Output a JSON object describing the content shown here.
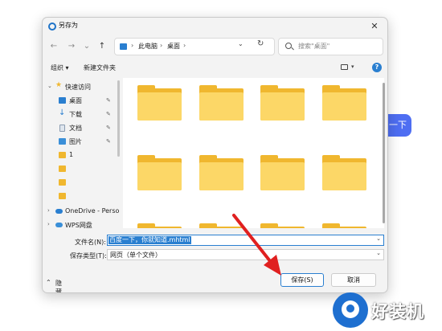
{
  "window": {
    "title": "另存为",
    "close_symbol": "✕"
  },
  "nav": {
    "back": "←",
    "forward": "→",
    "recent": "⌄",
    "up": "↑",
    "breadcrumb": [
      "此电脑",
      "桌面"
    ],
    "separator": "›",
    "address_dropdown": "⌄",
    "refresh": "↻",
    "search_placeholder": "搜索\"桌面\""
  },
  "toolbar": {
    "organize": "组织 ▾",
    "new_folder": "新建文件夹",
    "view_dropdown": "▾",
    "help": "?"
  },
  "sidebar": {
    "items": [
      {
        "label": "快速访问",
        "icon": "star-icon",
        "chevron": "⌄"
      },
      {
        "label": "桌面",
        "icon": "desktop-icon",
        "pin": "📌"
      },
      {
        "label": "下载",
        "icon": "download-icon",
        "pin": "📌"
      },
      {
        "label": "文档",
        "icon": "document-icon",
        "pin": "📌"
      },
      {
        "label": "图片",
        "icon": "picture-icon",
        "pin": "📌"
      },
      {
        "label": "1",
        "icon": "folder-icon"
      },
      {
        "label": "",
        "icon": "folder-icon"
      },
      {
        "label": "",
        "icon": "folder-icon"
      },
      {
        "label": "",
        "icon": "folder-icon"
      },
      {
        "label": "OneDrive - Perso",
        "icon": "cloud-icon",
        "chevron": "›"
      },
      {
        "label": "WPS网盘",
        "icon": "cloud-icon",
        "chevron": "›"
      }
    ]
  },
  "files": {
    "folder_count_visible": 12
  },
  "fields": {
    "filename_label": "文件名(N):",
    "filename_value": "百度一下，你就知道.mhtml",
    "type_label": "保存类型(T):",
    "type_value": "网页（单个文件）",
    "dropdown": "⌄"
  },
  "footer": {
    "hide_folders": "隐藏文件夹",
    "hide_chevron": "⌃",
    "save": "保存(S)",
    "cancel": "取消"
  },
  "background": {
    "button_text": "一下"
  },
  "watermark": {
    "text": "好装机"
  },
  "colors": {
    "accent": "#2a7fd0",
    "folder": "#f0b72f",
    "arrow": "#e02020"
  }
}
